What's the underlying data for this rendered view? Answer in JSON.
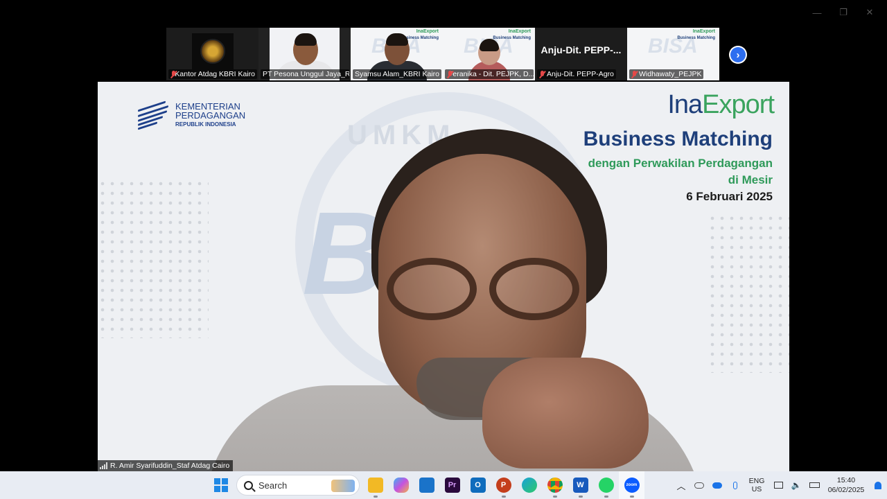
{
  "window": {
    "minimize": "—",
    "restore": "❐",
    "close": "✕"
  },
  "participants": [
    {
      "name": "Kantor Atdag KBRI Kairo",
      "muted": true,
      "kind": "emblem"
    },
    {
      "name": "PT Pesona Unggul Jaya_Ri...",
      "muted": false,
      "kind": "video",
      "active": true
    },
    {
      "name": "Syamsu Alam_KBRI Kairo",
      "muted": false,
      "kind": "video"
    },
    {
      "name": "Feranika - Dit. PEJPK, D...",
      "muted": true,
      "kind": "video"
    },
    {
      "name": "Anju-Dit. PEPP-Agro",
      "muted": true,
      "kind": "name",
      "display": "Anju-Dit.  PEPP-..."
    },
    {
      "name": "Widhawaty_PEJPK",
      "muted": true,
      "kind": "slide"
    }
  ],
  "next_page_icon": "chevron-right-icon",
  "slide": {
    "ministry_line1": "KEMENTERIAN",
    "ministry_line2": "PERDAGANGAN",
    "ministry_line3": "REPUBLIK INDONESIA",
    "brand_a": "Ina",
    "brand_b": "Export",
    "title": "Business Matching",
    "subtitle1": "dengan Perwakilan Perdagangan",
    "subtitle2": "di Mesir",
    "date": "6 Februari 2025",
    "watermark_ring": "UMKM",
    "watermark_big": "BISA"
  },
  "main_speaker": {
    "name": "R. Amir Syarifuddin_Staf Atdag Cairo"
  },
  "taskbar": {
    "search_placeholder": "Search",
    "apps": [
      "file-explorer",
      "copilot",
      "microsoft-store",
      "premiere-pro",
      "outlook",
      "powerpoint",
      "edge",
      "chrome",
      "word",
      "whatsapp",
      "zoom"
    ],
    "lang_line1": "ENG",
    "lang_line2": "US",
    "time": "15:40",
    "date": "06/02/2025"
  },
  "colors": {
    "accent_green": "#3ad07a",
    "brand_blue": "#1e3f7a",
    "brand_green": "#2f9a5a",
    "taskbar_bg": "#e8ecf3"
  }
}
